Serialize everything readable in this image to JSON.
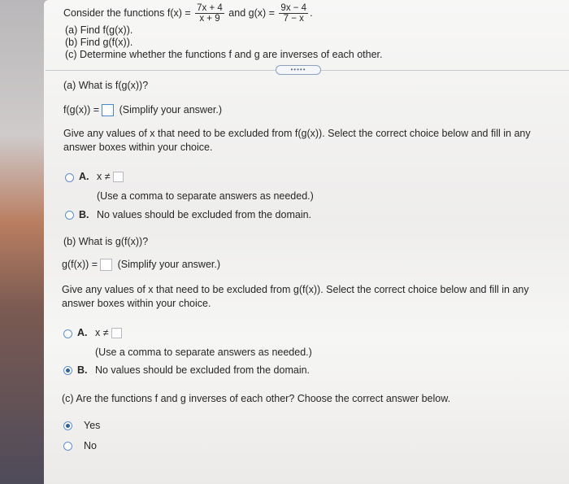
{
  "intro": {
    "prefix": "Consider the functions f(x) =",
    "f_num": "7x + 4",
    "f_den": "x + 9",
    "mid": "and g(x) =",
    "g_num": "9x − 4",
    "g_den": "7 − x",
    "end": ".",
    "item_a": "(a) Find f(g(x)).",
    "item_b": "(b) Find g(f(x)).",
    "item_c": "(c) Determine whether the functions f and g are inverses of each other."
  },
  "toggle_label": "•••••",
  "part_a": {
    "question": "(a) What is f(g(x))?",
    "expr": "f(g(x)) =",
    "hint": "(Simplify your answer.)",
    "instructions": "Give any values of x that need to be excluded from f(g(x)). Select the correct choice below and fill in any answer boxes within your choice.",
    "choice_a_label": "A.",
    "choice_a_text": "x ≠",
    "choice_a_note": "(Use a comma to separate answers as needed.)",
    "choice_b_label": "B.",
    "choice_b_text": "No values should be excluded from the domain."
  },
  "part_b": {
    "question": "(b) What is g(f(x))?",
    "expr": "g(f(x)) =",
    "hint": "(Simplify your answer.)",
    "instructions": "Give any values of x that need to be excluded from g(f(x)). Select the correct choice below and fill in any answer boxes within your choice.",
    "choice_a_label": "A.",
    "choice_a_text": "x ≠",
    "choice_a_note": "(Use a comma to separate answers as needed.)",
    "choice_b_label": "B.",
    "choice_b_text": "No values should be excluded from the domain."
  },
  "part_c": {
    "question": "(c) Are the functions f and g inverses of each other? Choose the correct answer below.",
    "yes": "Yes",
    "no": "No"
  },
  "selected": {
    "part_a": "none",
    "part_b": "B",
    "part_c": "Yes"
  }
}
